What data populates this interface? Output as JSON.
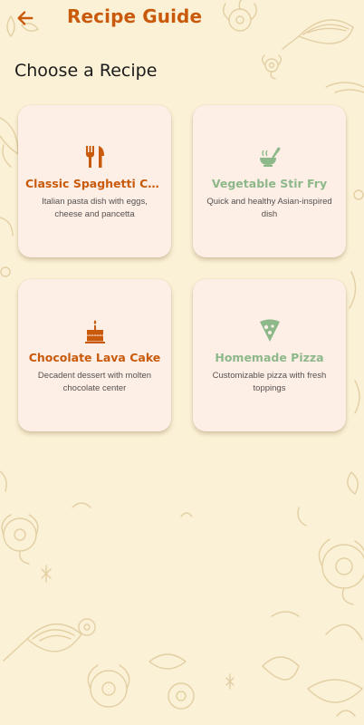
{
  "app_bar": {
    "title": "Recipe Guide",
    "back_icon": "arrow-left-icon",
    "accent_color": "#c95a0c"
  },
  "page": {
    "section_title": "Choose a Recipe",
    "background_color": "#fbf1d6"
  },
  "recipes": [
    {
      "title": "Classic Spaghetti Carb…",
      "description": "Italian pasta dish with eggs, cheese and pancetta",
      "icon": "fork-knife-icon",
      "color": "#c95a0c"
    },
    {
      "title": "Vegetable Stir Fry",
      "description": "Quick and healthy Asian-inspired dish",
      "icon": "ladle-pot-icon",
      "color": "#8db88a"
    },
    {
      "title": "Chocolate Lava Cake",
      "description": "Decadent dessert with molten chocolate center",
      "icon": "cake-icon",
      "color": "#c95a0c"
    },
    {
      "title": "Homemade Pizza",
      "description": "Customizable pizza with fresh toppings",
      "icon": "pizza-slice-icon",
      "color": "#8db88a"
    }
  ]
}
